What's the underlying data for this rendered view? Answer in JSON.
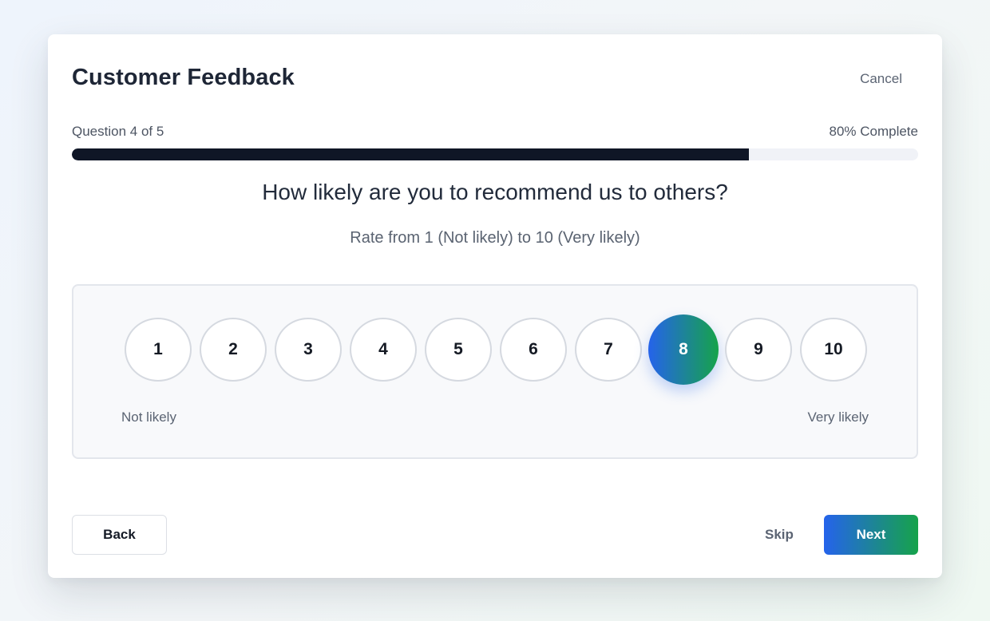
{
  "survey": {
    "title": "Customer Feedback",
    "cancel_label": "Cancel"
  },
  "progress": {
    "label": "Question 4 of 5",
    "percent_label": "80% Complete",
    "value": 0.8
  },
  "question": {
    "text": "How likely are you to recommend us to others?",
    "subtitle": "Rate from 1 (Not likely) to 10 (Very likely)"
  },
  "scale": {
    "options": [
      "1",
      "2",
      "3",
      "4",
      "5",
      "6",
      "7",
      "8",
      "9",
      "10"
    ],
    "selected": "8",
    "low_label": "Not likely",
    "high_label": "Very likely"
  },
  "footer": {
    "back_label": "Back",
    "skip_label": "Skip",
    "next_label": "Next"
  },
  "colors": {
    "accent_start": "#2563eb",
    "accent_end": "#16a34a",
    "progress_fill": "#0f1626"
  }
}
